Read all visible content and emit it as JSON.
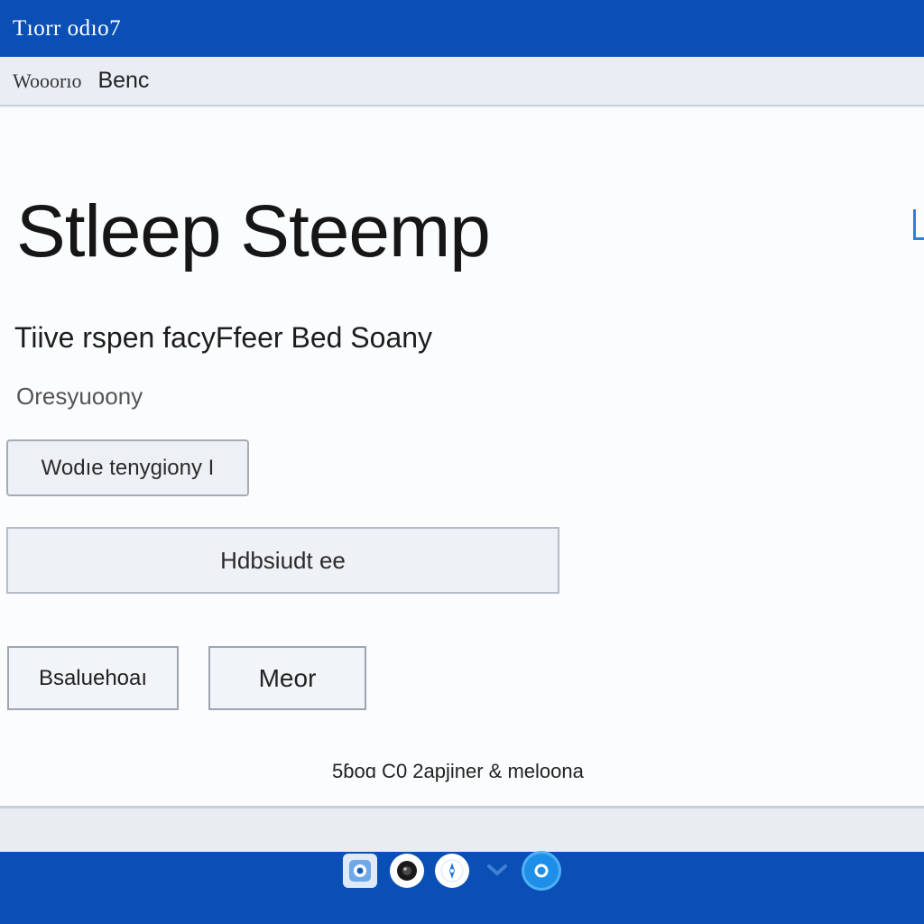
{
  "window": {
    "title": "Tıorr odıo7"
  },
  "breadcrumb": {
    "first": "Wooorıo",
    "second": "Benc"
  },
  "main": {
    "heading": "Stleep Steemp",
    "subheading": "Tiive rspen facyFfeer Bed Soany",
    "caption": "Oresyuoony",
    "secondary_button_label": "Wodıe tenygiony I",
    "wide_field_label": "Hdbsiudt ee",
    "button_a_label": "Bsaluehoaı",
    "button_b_label": "Meor",
    "footer_text": "5ɓoɑ C0 2apjiner & meloona"
  },
  "taskbar": {
    "icons": [
      "app-icon",
      "camera-icon",
      "compass-icon",
      "chevron-icon",
      "circle-app-icon"
    ]
  },
  "colors": {
    "titlebar": "#0a4fb5",
    "taskbar": "#0a4fb5",
    "accent": "#2f7fe0"
  }
}
